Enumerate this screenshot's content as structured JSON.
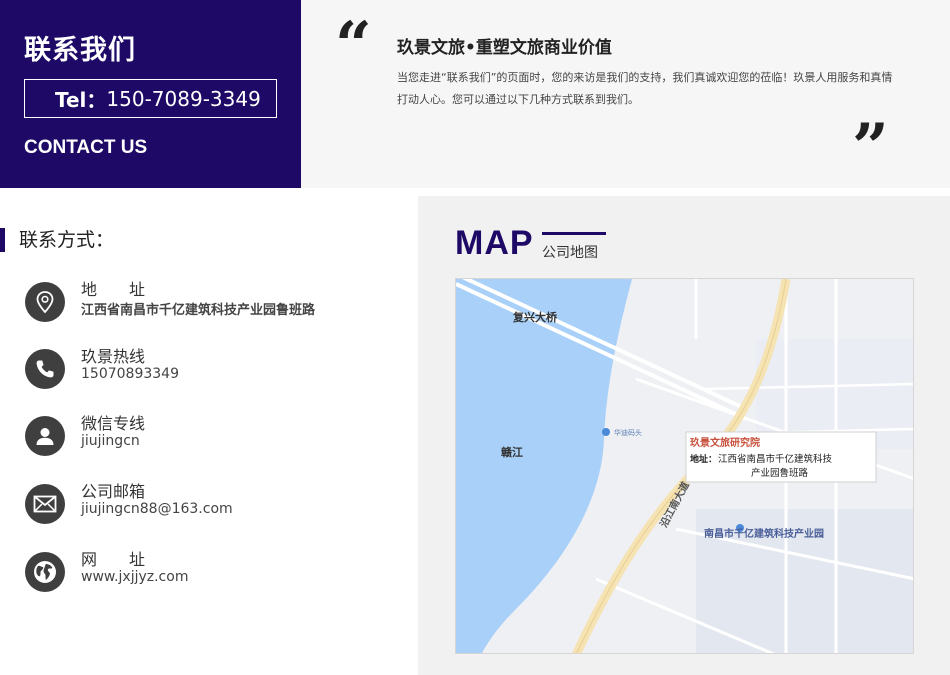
{
  "contact_box": {
    "title": "联系我们",
    "tel_label": "Tel：",
    "tel_number": "150-7089-3349",
    "title_en": "CONTACT US"
  },
  "intro": {
    "quote_open": "“",
    "quote_close": "”",
    "title": "玖景文旅•重塑文旅商业价值",
    "text": "当您走进“联系我们”的页面时，您的来访是我们的支持，我们真诚欢迎您的莅临！玖景人用服务和真情打动人心。您可以通过以下几种方式联系到我们。"
  },
  "contact_ways": {
    "title": "联系方式：",
    "items": [
      {
        "label": "地　　址",
        "value": "江西省南昌市千亿建筑科技产业园鲁班路",
        "icon": "location-pin-icon"
      },
      {
        "label": "玖景热线",
        "value": "15070893349",
        "icon": "phone-icon"
      },
      {
        "label": "微信专线",
        "value": "jiujingcn",
        "icon": "user-icon"
      },
      {
        "label": "公司邮箱",
        "value": "jiujingcn88@163.com",
        "icon": "mail-icon"
      },
      {
        "label": "网　　址",
        "value": "www.jxjjyz.com",
        "icon": "globe-icon"
      }
    ]
  },
  "map": {
    "title": "MAP",
    "subtitle": "公司地图",
    "labels": {
      "bridge": "复兴大桥",
      "river": "赣江",
      "road": "沿江南大道",
      "park": "南昌市千亿建筑科技产业园",
      "poi_company": "玖景文旅研究院",
      "poi_address_label": "地址：",
      "poi_address_line1": "江西省南昌市千亿建筑科技",
      "poi_address_line2": "产业园鲁班路",
      "small_poi": "华迪码头"
    }
  },
  "colors": {
    "brand": "#1e0a66",
    "icon_bg": "#3f3f3f",
    "river": "#a8d0f8",
    "road": "#f6e3b4"
  }
}
